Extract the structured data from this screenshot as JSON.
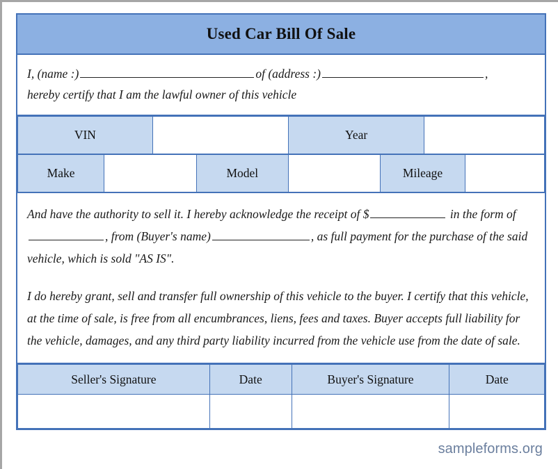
{
  "document": {
    "title": "Used Car Bill Of Sale"
  },
  "intro": {
    "line1_prefix": "I, (name :)",
    "line1_middle": "of (address :)",
    "line1_suffix": ",",
    "line2": "hereby certify that I am the lawful owner of this vehicle"
  },
  "vehicle_table": {
    "rows": [
      {
        "cells": [
          {
            "label": "VIN",
            "type": "label"
          },
          {
            "label": "",
            "type": "value"
          },
          {
            "label": "Year",
            "type": "label"
          },
          {
            "label": "",
            "type": "value"
          }
        ]
      },
      {
        "cells": [
          {
            "label": "Make",
            "type": "label"
          },
          {
            "label": "",
            "type": "value"
          },
          {
            "label": "Model",
            "type": "label"
          },
          {
            "label": "",
            "type": "value"
          },
          {
            "label": "Mileage",
            "type": "label"
          },
          {
            "label": "",
            "type": "value"
          }
        ]
      }
    ]
  },
  "body": {
    "paragraph1_part1": "And have the authority to sell it. I hereby acknowledge the receipt of $",
    "paragraph1_part2": "in the form of",
    "paragraph1_part3": ", from (Buyer's name)",
    "paragraph1_part4": ", as full payment for the purchase of the said vehicle, which is sold \"AS IS\".",
    "paragraph2": "I do hereby grant, sell and transfer full ownership of this vehicle to the buyer. I certify that this vehicle, at the time of sale, is free from all encumbrances, liens, fees and taxes. Buyer accepts full liability for the vehicle, damages, and any third party liability incurred from the vehicle use from the date of sale."
  },
  "signature_table": {
    "headers": [
      "Seller's Signature",
      "Date",
      "Buyer's Signature",
      "Date"
    ],
    "values": [
      "",
      "",
      "",
      ""
    ]
  },
  "watermark": {
    "text": "sampleforms.org"
  },
  "colors": {
    "title_band": "#8cb0e2",
    "cell_fill": "#c6d9f0",
    "border": "#4472b8",
    "frame": "#a6a6a6",
    "watermark_text": "#6b7f9e"
  }
}
